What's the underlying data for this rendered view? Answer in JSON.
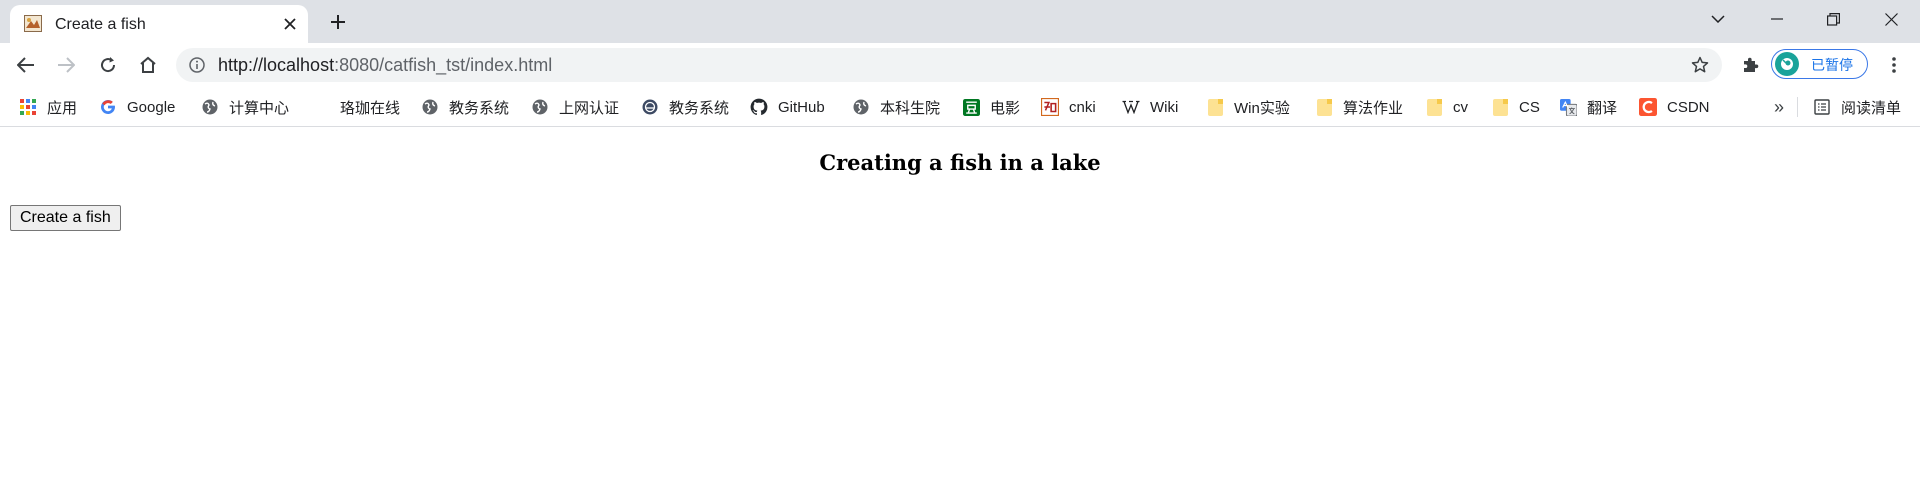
{
  "browser": {
    "tab": {
      "title": "Create a fish"
    },
    "toolbar": {
      "url_host": "http://localhost",
      "url_path": ":8080/catfish_tst/index.html",
      "profile_label": "已暂停"
    },
    "bookmarks": [
      {
        "label": "应用",
        "icon": "apps-grid-icon"
      },
      {
        "label": "Google",
        "icon": "google-icon"
      },
      {
        "label": "计算中心",
        "icon": "globe-icon"
      },
      {
        "label": "珞珈在线",
        "icon": "none"
      },
      {
        "label": "教务系统",
        "icon": "globe-icon"
      },
      {
        "label": "上网认证",
        "icon": "globe-icon"
      },
      {
        "label": "教务系统",
        "icon": "school-icon"
      },
      {
        "label": "GitHub",
        "icon": "github-icon"
      },
      {
        "label": "本科生院",
        "icon": "globe-icon"
      },
      {
        "label": "电影",
        "icon": "douban-icon"
      },
      {
        "label": "cnki",
        "icon": "cnki-icon"
      },
      {
        "label": "Wiki",
        "icon": "wikipedia-icon"
      },
      {
        "label": "Win实验",
        "icon": "folder-icon"
      },
      {
        "label": "算法作业",
        "icon": "folder-icon"
      },
      {
        "label": "cv",
        "icon": "folder-icon"
      },
      {
        "label": "CS",
        "icon": "folder-icon"
      },
      {
        "label": "翻译",
        "icon": "translate-icon"
      },
      {
        "label": "CSDN",
        "icon": "csdn-icon"
      }
    ],
    "overflow_label": "»",
    "reading_list_label": "阅读清单"
  },
  "page": {
    "heading": "Creating a fish in a lake",
    "button_label": "Create a fish"
  },
  "colors": {
    "tabstrip": "#dee1e6",
    "omnibox": "#f1f3f4",
    "profile_accent": "#1a73e8",
    "profile_avatar": "#1aa39a",
    "folder": "#fde293",
    "csdn": "#fc5531",
    "douban": "#007722"
  }
}
